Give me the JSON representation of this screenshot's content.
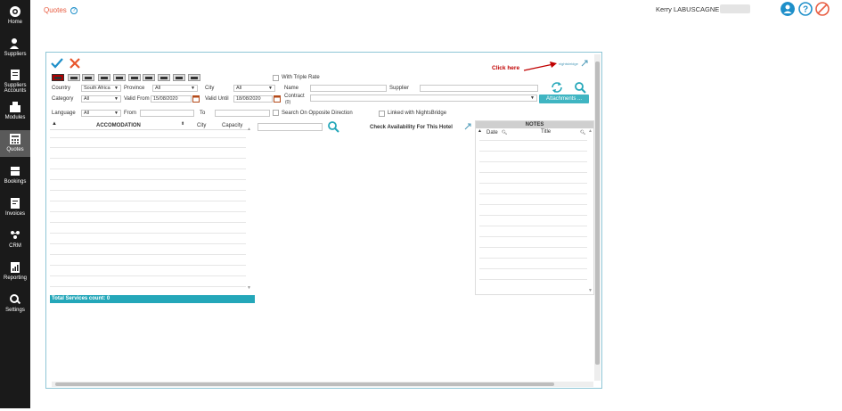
{
  "sidebar": {
    "items": [
      {
        "label": "Home",
        "icon": "home-icon"
      },
      {
        "label": "Suppliers",
        "icon": "user-icon"
      },
      {
        "label": "Suppliers Accounts",
        "icon": "accounts-icon"
      },
      {
        "label": "Modules",
        "icon": "modules-icon"
      },
      {
        "label": "Quotes",
        "icon": "calculator-icon"
      },
      {
        "label": "Bookings",
        "icon": "ticket-icon"
      },
      {
        "label": "Invoices",
        "icon": "invoice-icon"
      },
      {
        "label": "CRM",
        "icon": "crm-icon"
      },
      {
        "label": "Reporting",
        "icon": "report-icon"
      },
      {
        "label": "Settings",
        "icon": "settings-icon"
      }
    ]
  },
  "header": {
    "title": "Quotes",
    "user": "Kerry LABUSCAGNE -"
  },
  "colors": {
    "accent": "#e85c41",
    "teal": "#24a7b9",
    "confirm": "#1e8fc9",
    "cancel": "#e8562c"
  },
  "filters": {
    "with_triple_rate": "With Triple Rate",
    "country_label": "Country",
    "country_value": "South Africa",
    "province_label": "Province",
    "province_value": "All",
    "city_label": "City",
    "city_value": "All",
    "name_label": "Name",
    "supplier_label": "Supplier",
    "category_label": "Category",
    "category_value": "All",
    "valid_from_label": "Valid From",
    "valid_from_value": "15/08/2020",
    "valid_until_label": "Valid Until",
    "valid_until_value": "18/08/2020",
    "contract_label": "Contract",
    "contract_count": "(0)",
    "language_label": "Language",
    "language_value": "All",
    "from_label": "From",
    "to_label": "To",
    "search_opposite": "Search On Opposite Direction",
    "linked_nightsbridge": "Linked with NightsBridge",
    "attachments": "Attachments ..."
  },
  "table": {
    "col_accomodation": "ACCOMODATION",
    "col_city": "City",
    "col_capacity": "Capacity",
    "total_services": "Total Services count: 0",
    "check_availability": "Check Availability For This Hotel"
  },
  "notes": {
    "title": "NOTES",
    "col_date": "Date",
    "col_title": "Title"
  },
  "annotation": {
    "click_here": "Click here",
    "logo_text": "nightsbridge"
  }
}
